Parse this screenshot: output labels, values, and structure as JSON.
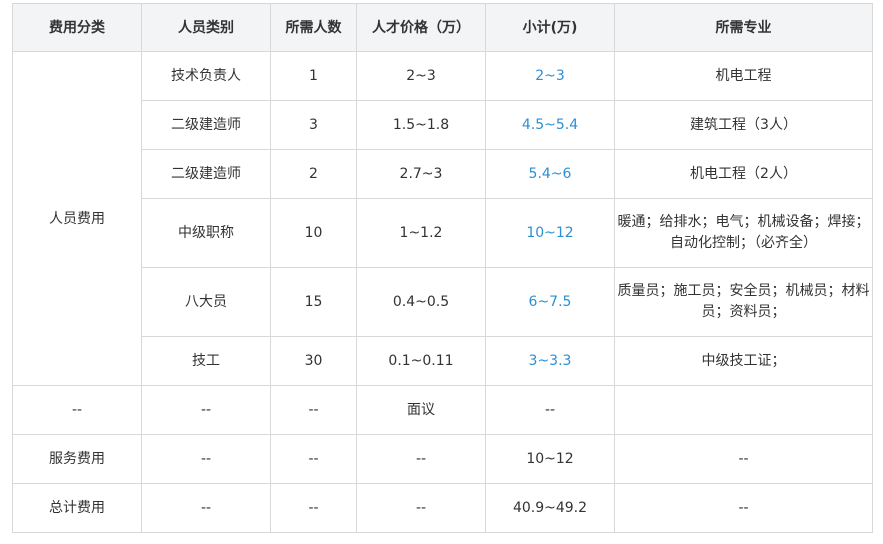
{
  "table": {
    "headers": [
      "费用分类",
      "人员类别",
      "所需人数",
      "人才价格（万）",
      "小计(万)",
      "所需专业"
    ],
    "group_label": "人员费用",
    "personnel_rows": [
      {
        "type": "技术负责人",
        "count": "1",
        "price": "2~3",
        "subtotal": "2~3",
        "specialty": "机电工程"
      },
      {
        "type": "二级建造师",
        "count": "3",
        "price": "1.5~1.8",
        "subtotal": "4.5~5.4",
        "specialty": "建筑工程（3人）"
      },
      {
        "type": "二级建造师",
        "count": "2",
        "price": "2.7~3",
        "subtotal": "5.4~6",
        "specialty": "机电工程（2人）"
      },
      {
        "type": "中级职称",
        "count": "10",
        "price": "1~1.2",
        "subtotal": "10~12",
        "specialty": "暖通；给排水；电气；机械设备；焊接；自动化控制；（必齐全）"
      },
      {
        "type": "八大员",
        "count": "15",
        "price": "0.4~0.5",
        "subtotal": "6~7.5",
        "specialty": "质量员；施工员；安全员；机械员；材料员；资料员；"
      },
      {
        "type": "技工",
        "count": "30",
        "price": "0.1~0.11",
        "subtotal": "3~3.3",
        "specialty": "中级技工证；"
      }
    ],
    "extra_rows": [
      {
        "category": "--",
        "type": "--",
        "count": "--",
        "price": "面议",
        "subtotal": "--",
        "specialty": ""
      },
      {
        "category": "服务费用",
        "type": "--",
        "count": "--",
        "price": "--",
        "subtotal": "10~12",
        "specialty": "--"
      },
      {
        "category": "总计费用",
        "type": "--",
        "count": "--",
        "price": "--",
        "subtotal": "40.9~49.2",
        "specialty": "--"
      }
    ]
  },
  "colors": {
    "subtotal_highlight": "#2b8fd6",
    "header_background": "#f2f4f6",
    "border": "#d8d8d8",
    "text": "#333333"
  }
}
